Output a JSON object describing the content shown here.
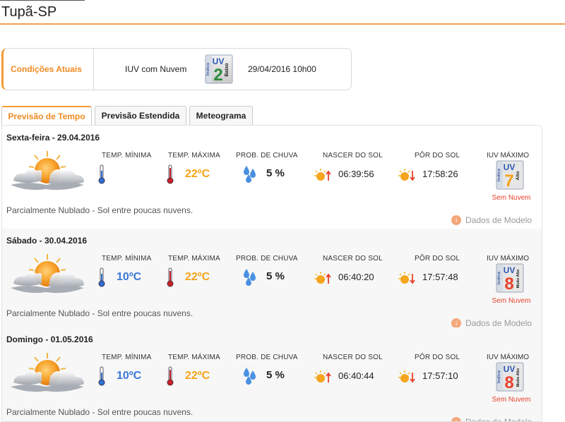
{
  "city": "Tupã-SP",
  "current": {
    "label": "Condições Atuais",
    "iuv_text": "IUV com Nuvem",
    "badge": {
      "uv": "UV",
      "value": "2",
      "side": "Baixo",
      "vertical": "Índice",
      "color": "#2e8b3c"
    },
    "datetime": "29/04/2016 10h00"
  },
  "tabs": [
    {
      "label": "Previsão de Tempo",
      "active": true
    },
    {
      "label": "Previsão Estendida",
      "active": false
    },
    {
      "label": "Meteograma",
      "active": false
    }
  ],
  "columns": {
    "min": "TEMP. MÍNIMA",
    "max": "TEMP. MÁXIMA",
    "rain": "PROB. DE CHUVA",
    "sunrise": "NASCER DO SOL",
    "sunset": "PÔR DO SOL",
    "uvmax": "IUV MÁXIMO"
  },
  "days": [
    {
      "title": "Sexta-feira - 29.04.2016",
      "icon": "partly-cloudy-icon",
      "min": "",
      "max": "22ºC",
      "rain": "5 %",
      "sunrise": "06:39:56",
      "sunset": "17:58:26",
      "uv": {
        "value": "7",
        "side": "Alto",
        "color": "#f5a318"
      },
      "uv_note": "Sem Nuvem",
      "desc": "Parcialmente Nublado - Sol entre poucas nuvens.",
      "dados": "Dados de Modelo"
    },
    {
      "title": "Sábado - 30.04.2016",
      "icon": "partly-cloudy-icon",
      "min": "10ºC",
      "max": "22ºC",
      "rain": "5 %",
      "sunrise": "06:40:20",
      "sunset": "17:57:48",
      "uv": {
        "value": "8",
        "side": "Muito Alto",
        "color": "#e8412c"
      },
      "uv_note": "Sem Nuvem",
      "desc": "Parcialmente Nublado - Sol entre poucas nuvens.",
      "dados": "Dados de Modelo"
    },
    {
      "title": "Domingo - 01.05.2016",
      "icon": "partly-cloudy-icon",
      "min": "10ºC",
      "max": "22ºC",
      "rain": "5 %",
      "sunrise": "06:40:44",
      "sunset": "17:57:10",
      "uv": {
        "value": "8",
        "side": "Muito Alto",
        "color": "#e8412c"
      },
      "uv_note": "Sem Nuvem",
      "desc": "Parcialmente Nublado - Sol entre poucas nuvens.",
      "dados": "Dados de Modelo"
    }
  ],
  "colors": {
    "accent": "#f39c33",
    "accent_text": "#f08b22",
    "min_temp": "#3a78d6",
    "max_temp": "#f5a318",
    "note": "#e8412c"
  }
}
